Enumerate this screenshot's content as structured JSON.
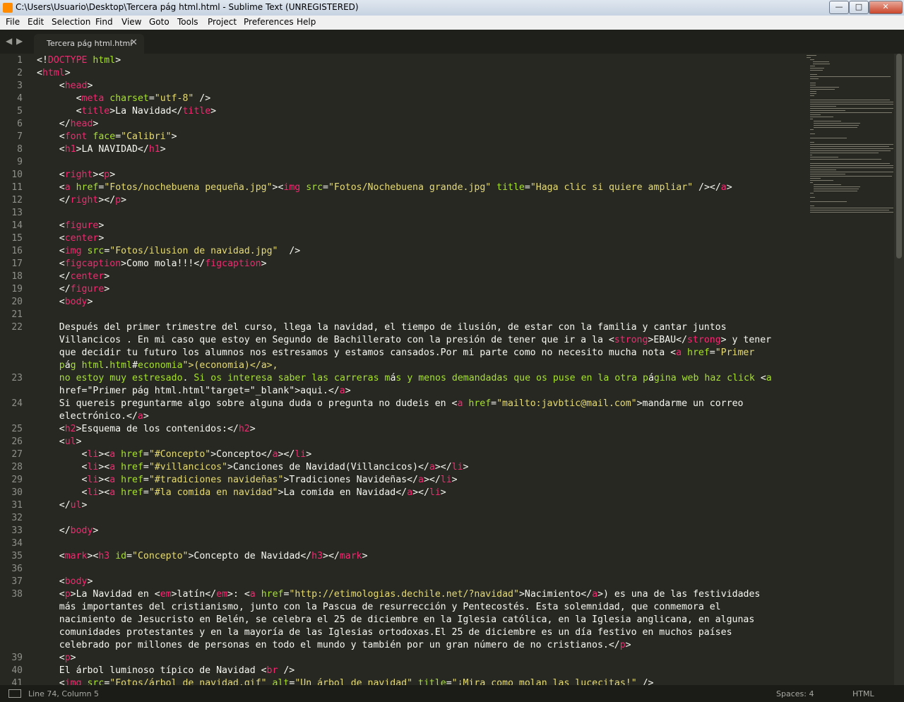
{
  "window": {
    "title": "C:\\Users\\Usuario\\Desktop\\Tercera pág html.html - Sublime Text (UNREGISTERED)",
    "minimize_glyph": "—",
    "maximize_glyph": "□",
    "close_glyph": "✕"
  },
  "menu": [
    "File",
    "Edit",
    "Selection",
    "Find",
    "View",
    "Goto",
    "Tools",
    "Project",
    "Preferences",
    "Help"
  ],
  "tabs": {
    "nav_left": "◀",
    "nav_right": "▶",
    "active": "Tercera pág html.html",
    "close_glyph": "✕"
  },
  "gutter": {
    "line_numbers": [
      1,
      2,
      3,
      4,
      5,
      6,
      7,
      8,
      9,
      10,
      11,
      12,
      13,
      14,
      15,
      16,
      17,
      18,
      19,
      20,
      21,
      22,
      23,
      24,
      25,
      26,
      27,
      28,
      29,
      30,
      31,
      32,
      33,
      34,
      35,
      36,
      37,
      38,
      39,
      40,
      41
    ]
  },
  "code_lines": [
    "<!DOCTYPE html>",
    "<html>",
    "    <head>",
    "       <meta charset=\"utf-8\" />",
    "       <title>La Navidad</title>",
    "    </head>",
    "    <font face=\"Calibri\">",
    "    <h1>LA NAVIDAD</h1>",
    "",
    "    <right><p>",
    "    <a href=\"Fotos/nochebuena pequeña.jpg\"><img src=\"Fotos/Nochebuena grande.jpg\" title=\"Haga clic si quiere ampliar\" /></a>",
    "    </right></p>",
    "",
    "    <figure>",
    "    <center>",
    "    <img src=\"Fotos/ilusion de navidad.jpg\"  />",
    "    <figcaption>Como mola!!!</figcaption>",
    "    </center>",
    "    </figure>",
    "    <body>",
    "",
    "    Después del primer trimestre del curso, llega la navidad, el tiempo de ilusión, de estar con la familia y cantar juntos",
    "    Villancicos . En mi caso que estoy en Segundo de Bachillerato con la presión de tener que ir a la <strong>EBAU</strong> y tener",
    "    que decidir tu futuro los alumnos nos estresamos y estamos cansados.Por mi parte como no necesito mucha nota <a href=\"Primer",
    "    pág html.html#economia\">(economia)</a>,",
    "    no estoy muy estresado. Si os interesa saber las carreras más y menos demandadas que os puse en la otra página web haz click <a",
    "    href=\"Primer pág html.html\"target=\"_blank\">aqui.</a>",
    "    Si quereis preguntarme algo sobre alguna duda o pregunta no dudeis en <a href=\"mailto:javbtic@mail.com\">mandarme un correo",
    "    electrónico.</a>",
    "    <h2>Esquema de los contenidos:</h2>",
    "    <ul>",
    "        <li><a href=\"#Concepto\">Concepto</a></li>",
    "        <li><a href=\"#villancicos\">Canciones de Navidad(Villancicos)</a></li>",
    "        <li><a href=\"#tradiciones navideñas\">Tradiciones Navideñas</a></li>",
    "        <li><a href=\"#la comida en navidad\">La comida en Navidad</a></li>",
    "    </ul>",
    "",
    "    </body>",
    "",
    "    <mark><h3 id=\"Concepto\">Concepto de Navidad</h3></mark>",
    "",
    "    <body>",
    "    <p>La Navidad en <em>latín</em>: <a href=\"http://etimologias.dechile.net/?navidad\">Nacimiento</a>) es una de las festividades",
    "    más importantes del cristianismo, junto con la Pascua de resurrección y Pentecostés. Esta solemnidad, que conmemora el",
    "    nacimiento de Jesucristo en Belén, se celebra el 25 de diciembre en la Iglesia católica, en la Iglesia anglicana, en algunas",
    "    comunidades protestantes y en la mayoría de las Iglesias ortodoxas.El 25 de diciembre es un día festivo en muchos países",
    "    celebrado por millones de personas en todo el mundo y también por un gran número de no cristianos.</p>",
    "    <p>",
    "    El árbol luminoso típico de Navidad <br />",
    "    <img src=\"Fotos/árbol de navidad.gif\" alt=\"Un árbol de navidad\" title=\"¡Mira como molan las lucecitas!\" />"
  ],
  "status": {
    "position": "Line 74, Column 5",
    "indent": "Spaces: 4",
    "syntax": "HTML"
  },
  "colors": {
    "background": "#272822",
    "tag": "#f92672",
    "attribute": "#a6e22e",
    "string": "#e6db74",
    "text": "#f8f8f2",
    "gutter_text": "#8f908a"
  }
}
